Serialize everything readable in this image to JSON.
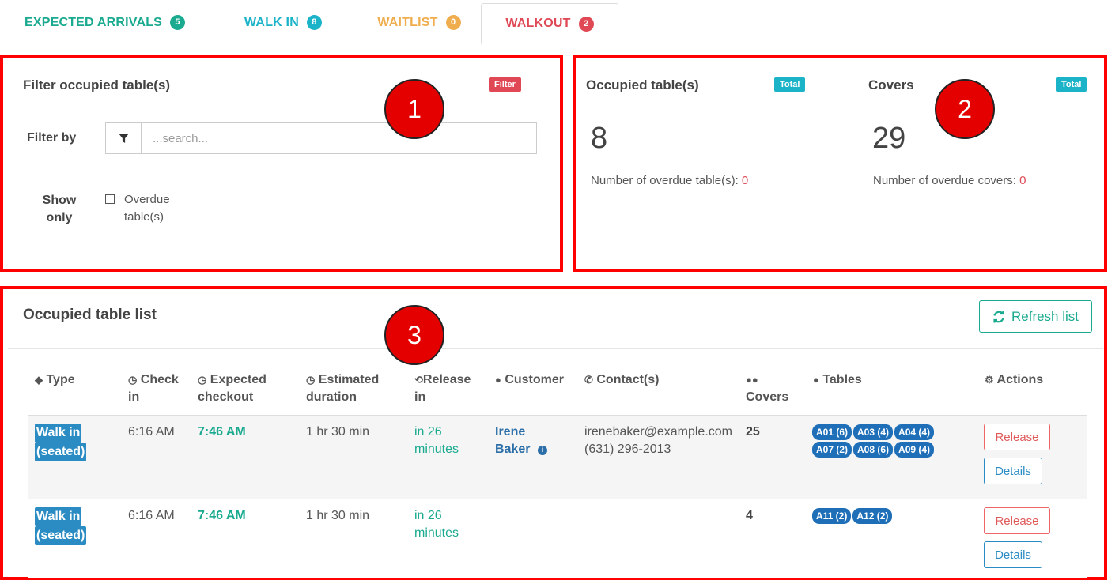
{
  "tabs": [
    {
      "label": "EXPECTED ARRIVALS",
      "count": "5",
      "color": "#1aaa8f"
    },
    {
      "label": "WALK IN",
      "count": "8",
      "color": "#1ab3c8"
    },
    {
      "label": "WAITLIST",
      "count": "0",
      "color": "#f0ad4e"
    },
    {
      "label": "WALKOUT",
      "count": "2",
      "color": "#e04855"
    }
  ],
  "annotations": [
    "1",
    "2",
    "3"
  ],
  "filter_panel": {
    "title": "Filter occupied table(s)",
    "tag": "Filter",
    "filter_by_label": "Filter by",
    "search_placeholder": "...search...",
    "show_only_line1": "Show",
    "show_only_line2": "only",
    "checkbox_line1": "Overdue",
    "checkbox_line2": "table(s)"
  },
  "stats": {
    "occupied": {
      "title": "Occupied table(s)",
      "tag": "Total",
      "value": "8",
      "sub_label": "Number of overdue table(s): ",
      "sub_value": "0"
    },
    "covers": {
      "title": "Covers",
      "tag": "Total",
      "value": "29",
      "sub_label": "Number of overdue covers: ",
      "sub_value": "0"
    }
  },
  "list": {
    "title": "Occupied table list",
    "refresh_label": "Refresh list",
    "headers": {
      "type": "Type",
      "checkin_1": "Check",
      "checkin_2": "in",
      "expected_1": "Expected",
      "expected_2": "checkout",
      "estimated_1": "Estimated",
      "estimated_2": "duration",
      "release_1": "Release",
      "release_2": "in",
      "customer": "Customer",
      "contacts": "Contact(s)",
      "covers": "Covers",
      "tables": "Tables",
      "actions": "Actions"
    },
    "rows": [
      {
        "type_1": "Walk in",
        "type_2": "(seated)",
        "checkin": "6:16 AM",
        "expected": "7:46 AM",
        "duration": "1 hr 30 min",
        "release_1": "in 26",
        "release_2": "minutes",
        "customer_1": "Irene",
        "customer_2": "Baker",
        "email": "irenebaker@example.com",
        "phone": "(631) 296-2013",
        "covers": "25",
        "tables": [
          "A01 (6)",
          "A03 (4)",
          "A04 (4)",
          "A07 (2)",
          "A08 (6)",
          "A09 (4)"
        ],
        "release_btn": "Release",
        "details_btn": "Details"
      },
      {
        "type_1": "Walk in",
        "type_2": "(seated)",
        "checkin": "6:16 AM",
        "expected": "7:46 AM",
        "duration": "1 hr 30 min",
        "release_1": "in 26",
        "release_2": "minutes",
        "customer_1": "",
        "customer_2": "",
        "email": "",
        "phone": "",
        "covers": "4",
        "tables": [
          "A11 (2)",
          "A12 (2)"
        ],
        "release_btn": "Release",
        "details_btn": "Details"
      }
    ]
  }
}
